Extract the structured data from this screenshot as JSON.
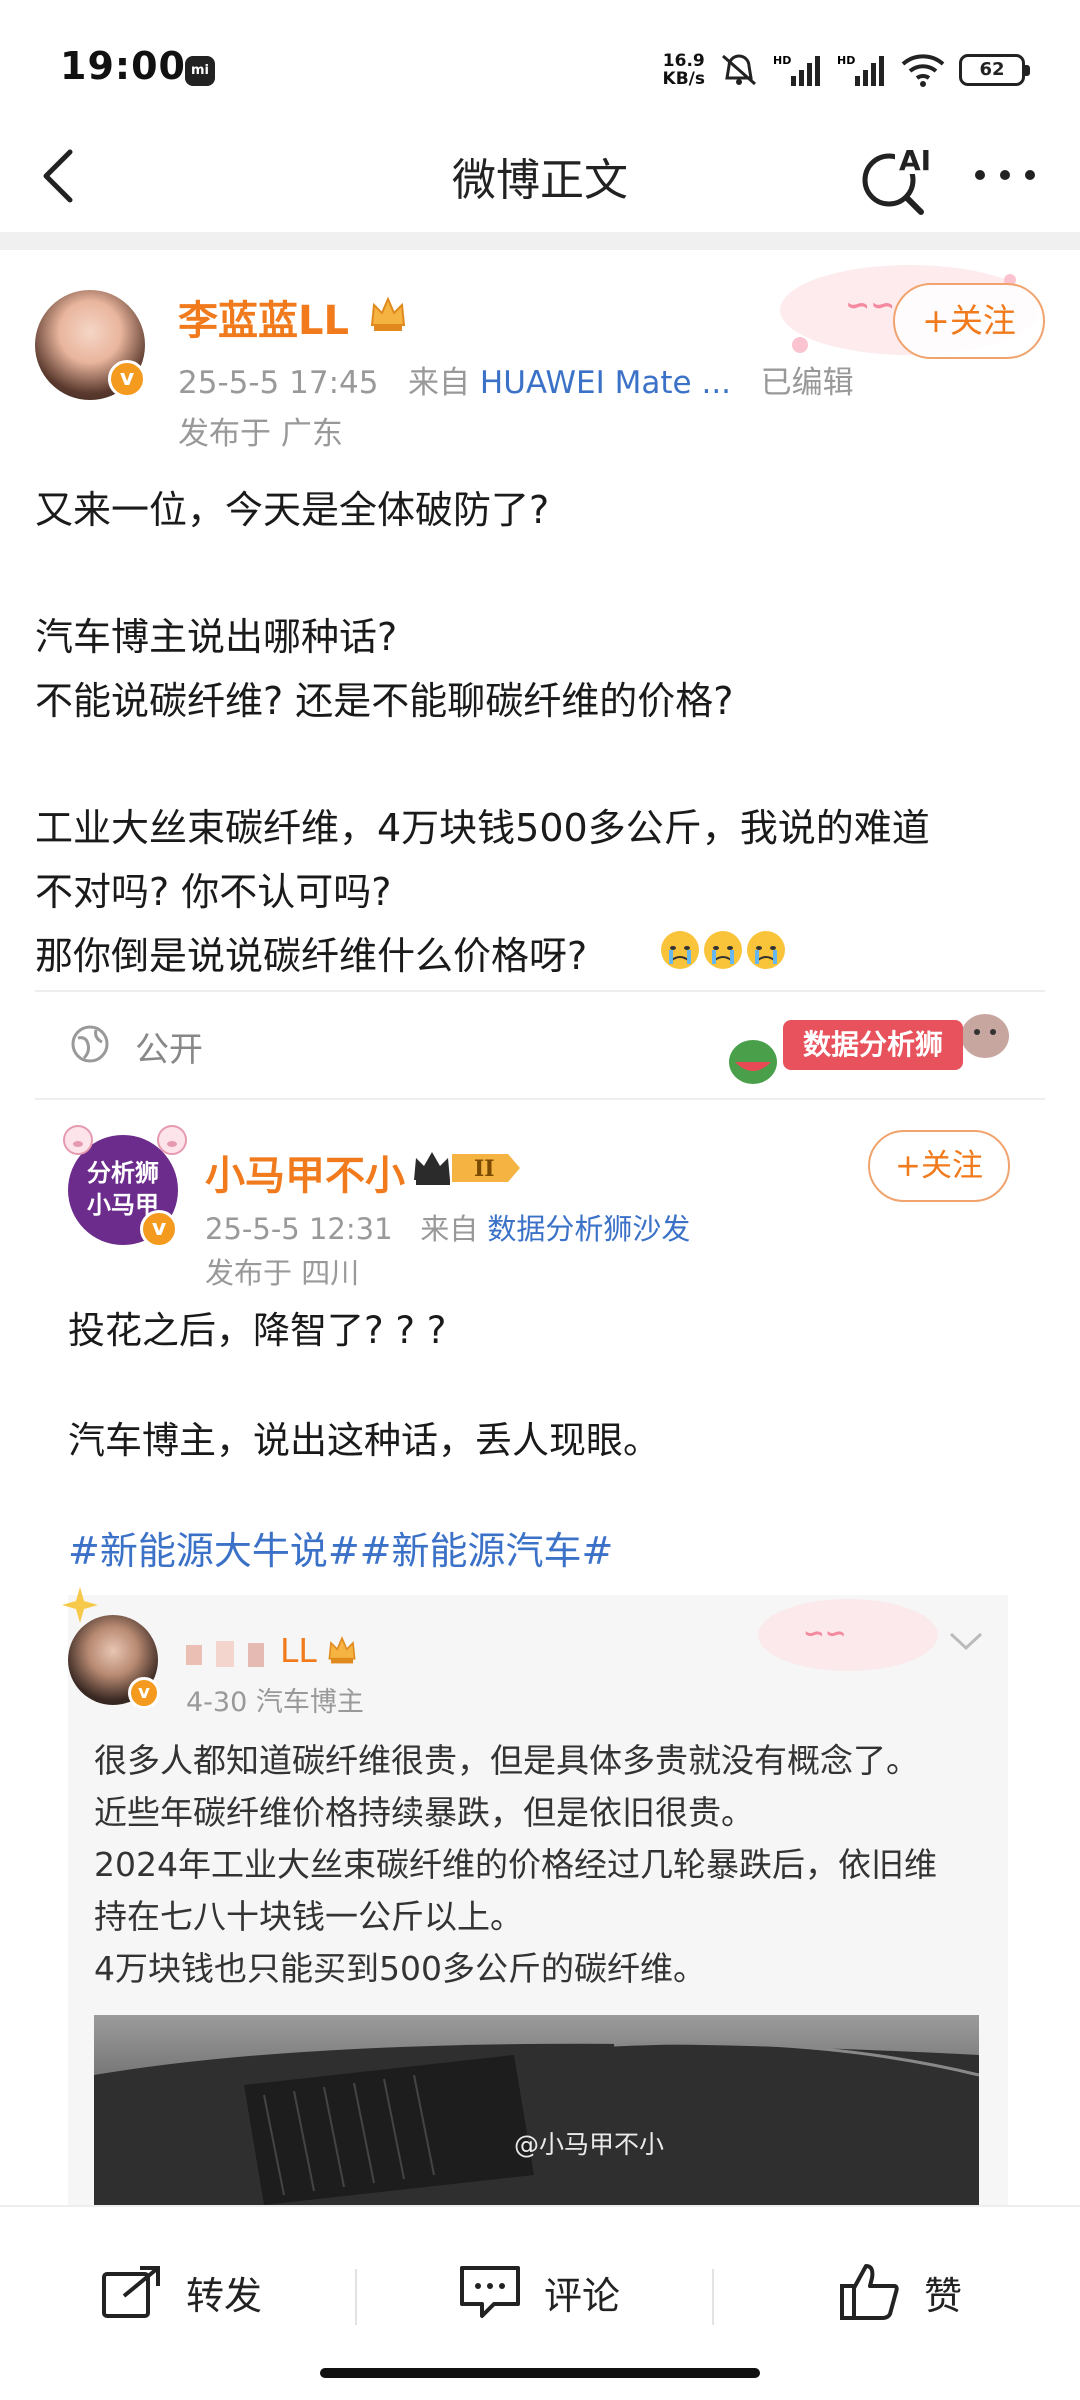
{
  "status_bar": {
    "time": "19:00",
    "net_speed_value": "16.9",
    "net_speed_unit": "KB/s",
    "battery": "62",
    "icons": [
      "mi-icon",
      "mute-icon",
      "hd-signal-icon",
      "hd-signal-icon",
      "wifi-icon",
      "battery-icon"
    ]
  },
  "nav": {
    "title": "微博正文",
    "ai_label": "AI"
  },
  "post": {
    "username": "李蓝蓝LL",
    "meta_time": "25-5-5 17:45",
    "meta_from": "来自",
    "meta_source": "HUAWEI Mate ...",
    "meta_edited": "已编辑",
    "location": "发布于 广东",
    "follow_label": "+关注",
    "text_1": "又来一位，今天是全体破防了?",
    "text_2": "汽车博主说出哪种话?\n不能说碳纤维? 还是不能聊碳纤维的价格?",
    "text_3": "工业大丝束碳纤维，4万块钱500多公斤，我说的难道\n不对吗? 你不认可吗?\n那你倒是说说碳纤维什么价格呀?",
    "emoji": [
      "crying-face-icon",
      "crying-face-icon",
      "crying-face-icon"
    ],
    "visibility": "公开",
    "stamp_text": "数据分析狮"
  },
  "repost": {
    "avatar_line1": "分析狮",
    "avatar_line2": "小马甲",
    "username": "小马甲不小",
    "level_badge": "II",
    "meta_time": "25-5-5 12:31",
    "meta_from": "来自",
    "meta_source": "数据分析狮沙发",
    "location": "发布于 四川",
    "follow_label": "+关注",
    "text_1": "投花之后，降智了? ? ?",
    "text_2": "汽车博主，说出这种话，丢人现眼。",
    "hashtags": "#新能源大牛说##新能源汽车#"
  },
  "quoted": {
    "name_visible": "LL",
    "meta": "4-30  汽车博主",
    "text": "很多人都知道碳纤维很贵，但是具体多贵就没有概念了。\n近些年碳纤维价格持续暴跌，但是依旧很贵。\n2024年工业大丝束碳纤维的价格经过几轮暴跌后，依旧维\n持在七八十块钱一公斤以上。\n4万块钱也只能买到500多公斤的碳纤维。",
    "watermark": "@小马甲不小"
  },
  "bottom_bar": {
    "repost_label": "转发",
    "comment_label": "评论",
    "like_label": "赞"
  },
  "colors": {
    "username": "#f07a1c",
    "link": "#3b72c8",
    "meta": "#999999",
    "verify": "#f39a1f"
  }
}
